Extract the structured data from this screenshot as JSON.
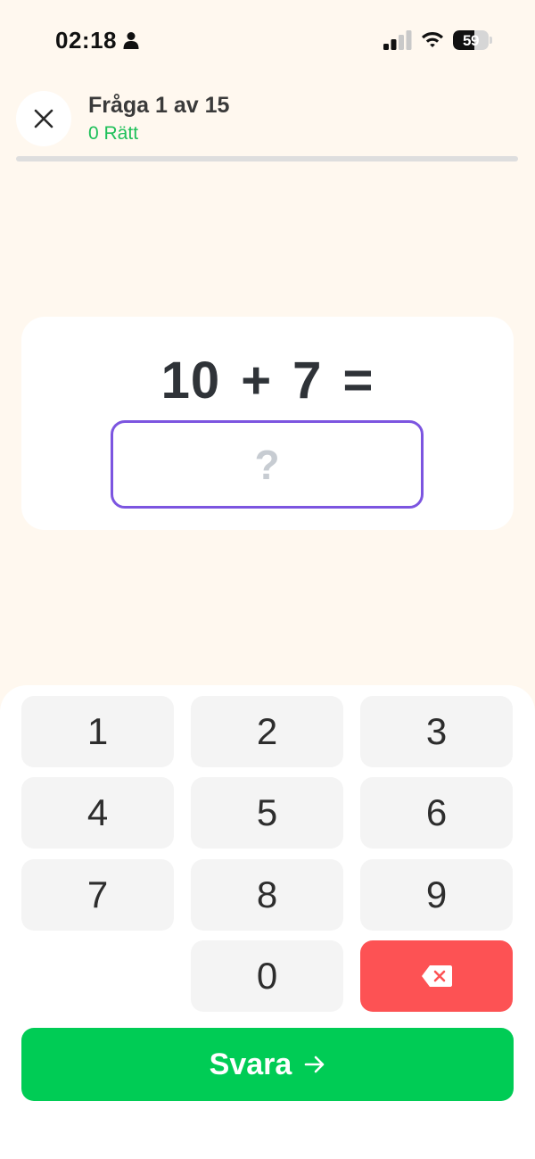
{
  "status_bar": {
    "time": "02:18",
    "battery_percent": "59",
    "battery_level": 0.59,
    "icons": [
      "person-icon",
      "cellular-signal-icon",
      "wifi-icon",
      "battery-icon"
    ]
  },
  "header": {
    "question_counter": "Fråga 1 av 15",
    "score": "0 Rätt",
    "close_icon": "close-icon",
    "progress": 0
  },
  "question": {
    "equation": "10 + 7 =",
    "answer_placeholder": "?"
  },
  "keypad": {
    "keys": [
      "1",
      "2",
      "3",
      "4",
      "5",
      "6",
      "7",
      "8",
      "9",
      "0"
    ],
    "backspace_icon": "backspace-icon"
  },
  "submit": {
    "label": "Svara",
    "icon": "arrow-right-icon"
  },
  "colors": {
    "background": "#fff8ef",
    "accent_green": "#00cc55",
    "score_green": "#1fc05a",
    "input_border": "#7c55e0",
    "backspace_red": "#fd5254"
  }
}
